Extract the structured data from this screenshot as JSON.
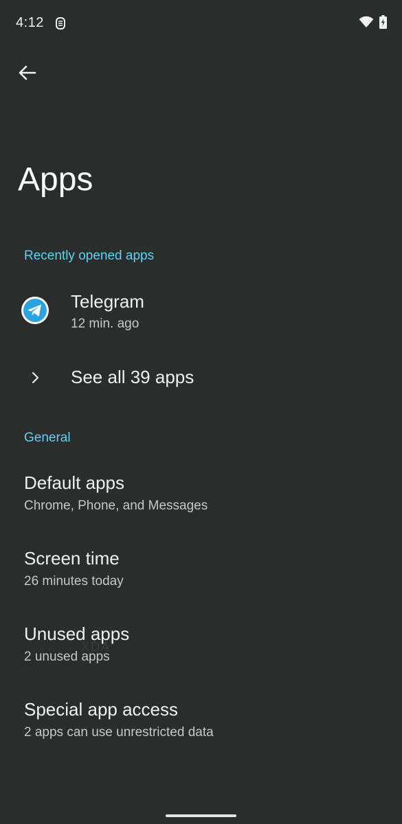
{
  "status_bar": {
    "time": "4:12",
    "app_icon": "notification-app-icon",
    "wifi_icon": "wifi-icon",
    "battery_icon": "battery-charging-icon"
  },
  "toolbar": {
    "back_icon": "back-arrow-icon"
  },
  "page": {
    "title": "Apps"
  },
  "recent": {
    "header": "Recently opened apps",
    "apps": [
      {
        "name": "Telegram",
        "time": "12 min. ago",
        "icon": "telegram-icon"
      }
    ],
    "see_all_label": "See all 39 apps"
  },
  "general": {
    "header": "General",
    "items": [
      {
        "title": "Default apps",
        "subtitle": "Chrome, Phone, and Messages"
      },
      {
        "title": "Screen time",
        "subtitle": "26 minutes today"
      },
      {
        "title": "Unused apps",
        "subtitle": "2 unused apps"
      },
      {
        "title": "Special app access",
        "subtitle": "2 apps can use unrestricted data"
      }
    ]
  },
  "watermark": "XDA",
  "colors": {
    "background": "#2a2d2c",
    "accent": "#5dd2f0",
    "telegram_blue": "#2aa3e0"
  }
}
